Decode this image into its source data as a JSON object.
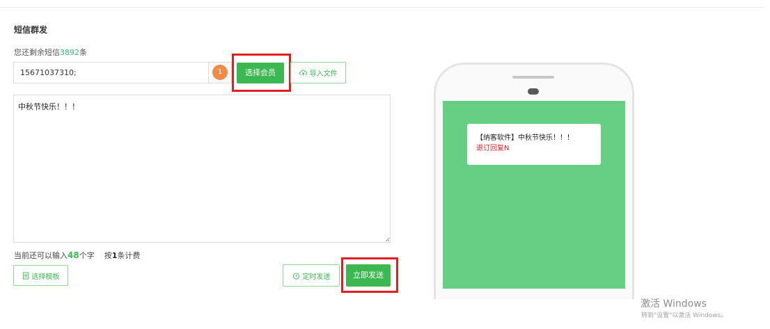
{
  "section_title": "短信群发",
  "remaining": {
    "prefix": "您还剩余短信",
    "count": "3892",
    "suffix": "条"
  },
  "recipients": {
    "value": "15671037310;",
    "count_badge": "1"
  },
  "buttons": {
    "select_member": "选择会员",
    "import_file": "导入文件",
    "select_template": "选择模板",
    "timed_send": "定时发送",
    "send_now": "立即发送"
  },
  "message": {
    "content": "中秋节快乐！！！"
  },
  "counter": {
    "prefix": "当前还可以输入",
    "chars": "48",
    "mid": "个字",
    "by": "按",
    "sms_count": "1",
    "suffix": "条计费"
  },
  "preview": {
    "text": "【纳客软件】中秋节快乐！！！",
    "unsubscribe": "退订回复N"
  },
  "watermark": {
    "title": "激活 Windows",
    "subtitle": "转到\"设置\"以激活 Windows。"
  },
  "colors": {
    "accent": "#3cb852",
    "badge": "#f08c4a",
    "highlight": "#e02020",
    "phone_screen": "#67cf84"
  },
  "icons": {
    "import": "cloud-upload-icon",
    "template": "document-icon",
    "timed": "clock-icon",
    "phone": "phone-mockup"
  }
}
